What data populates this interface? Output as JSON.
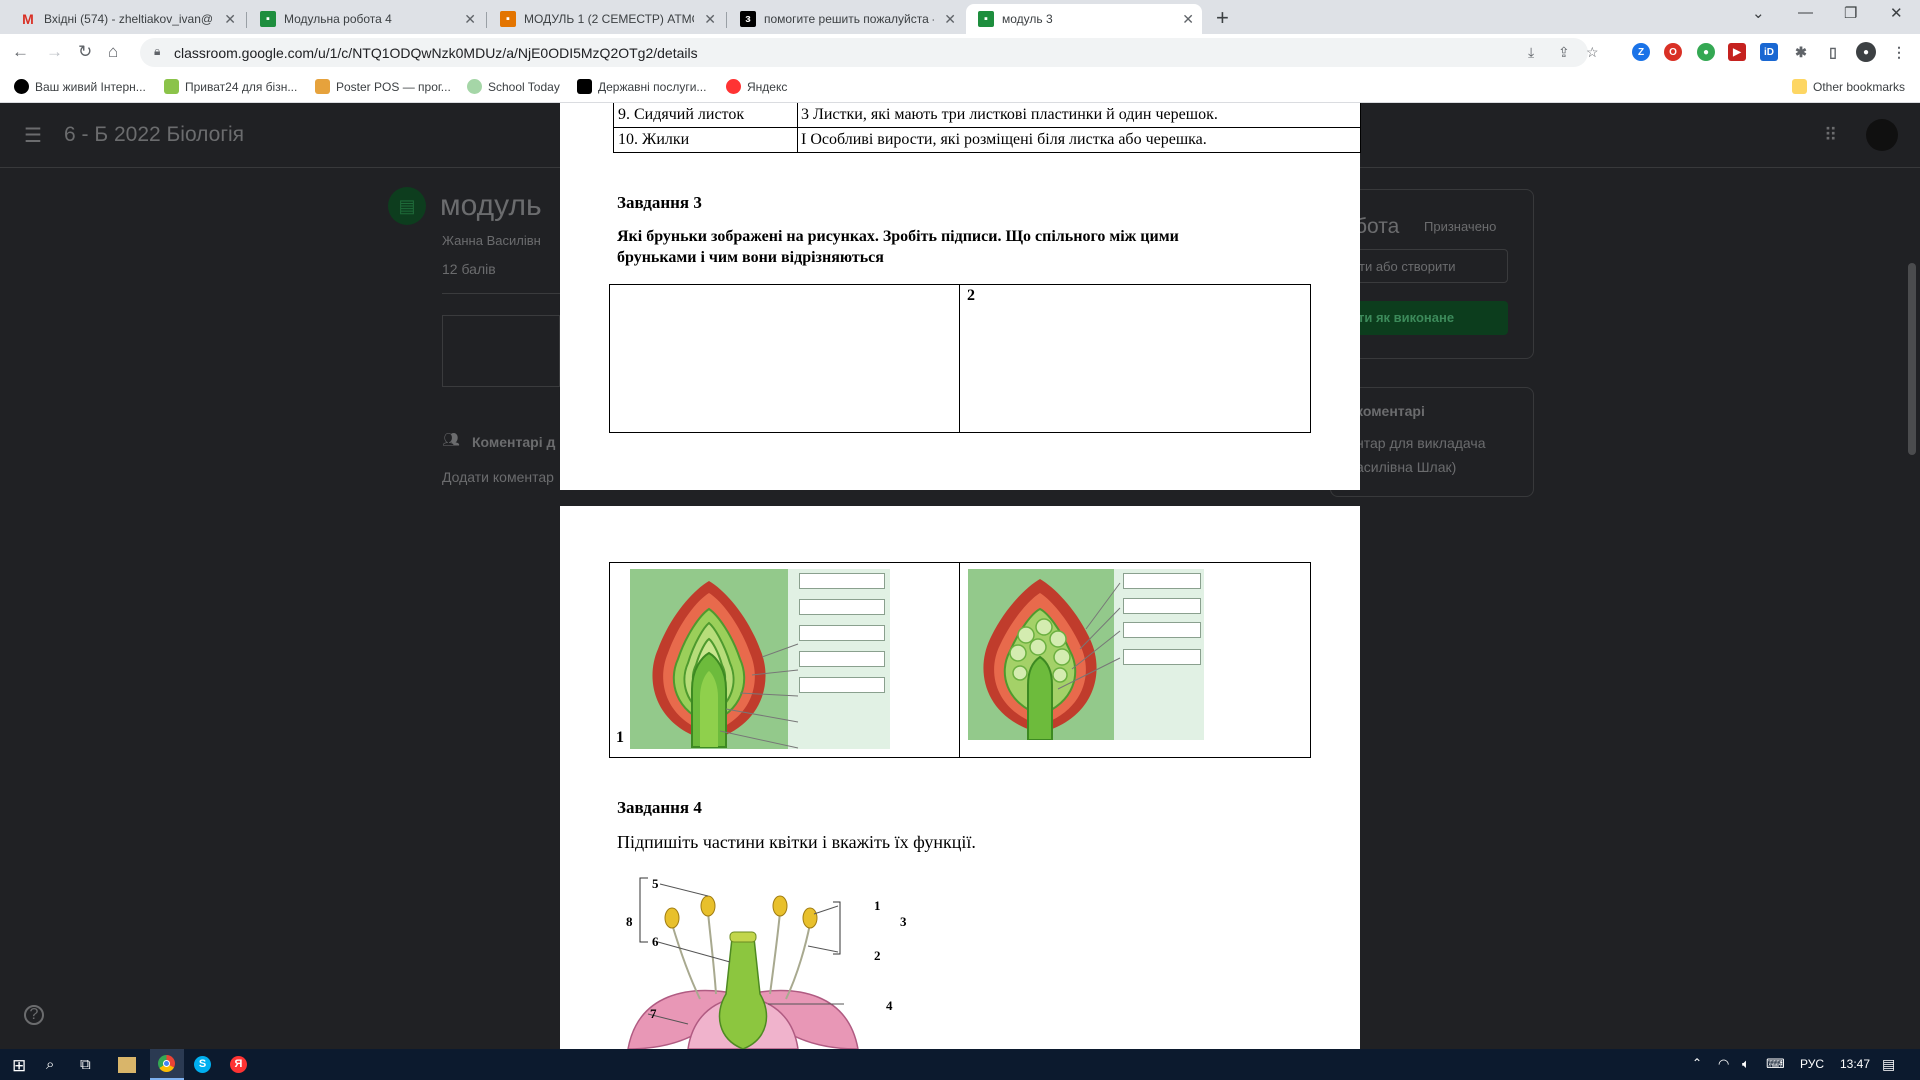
{
  "tabs": [
    {
      "label": "Вхідні (574) - zheltiakov_ivan@1",
      "icon": "gmail-icon"
    },
    {
      "label": "Модульна робота 4",
      "icon": "classroom-icon"
    },
    {
      "label": "МОДУЛЬ 1 (2 СЕМЕСТР) АТМОС",
      "icon": "forms-icon"
    },
    {
      "label": "помогите решить пожалуйста -",
      "icon": "znanija-icon"
    },
    {
      "label": "модуль 3",
      "icon": "classroom-icon"
    }
  ],
  "url": "classroom.google.com/u/1/c/NTQ1ODQwNzk0MDUz/a/NjE0ODI5MzQ2OTg2/details",
  "bookmarks": [
    "Ваш живий Інтерн...",
    "Приват24 для бізн...",
    "Poster POS — прог...",
    "School Today",
    "Державні послуги...",
    "Яндекс"
  ],
  "other_bookmarks": "Other bookmarks",
  "classroom": {
    "class_name": "6 - Б 2022 Біологія",
    "assignment_title": "модуль",
    "teacher": "Жанна Василівн",
    "points": "12 балів",
    "comments_label": "Коментарі д",
    "add_comment": "Додати коментар",
    "work_title": "бота",
    "status": "Призначено",
    "add_create": "ти або створити",
    "mark_done": "ти як виконане",
    "private_comments": "коментарі",
    "private_comment_for": "нтар для викладача",
    "teacher_name": "асилівна Шлак)"
  },
  "doc": {
    "table_rows": [
      {
        "term": "9.  Сидячий листок",
        "def": "3   Листки, які мають три листкові пластинки й один черешок."
      },
      {
        "term": "10.  Жилки",
        "def": "І   Особливі вирости, які розміщені біля листка або черешка."
      }
    ],
    "task3_title": "Завдання 3",
    "task3_text_line1": "Які бруньки зображені на рисунках. Зробіть підписи. Що спільного між цими",
    "task3_text_line2": "бруньками  і чим вони відрізняються",
    "answer_cell_label": "2",
    "figure1_label": "1",
    "task4_title": "Завдання 4",
    "task4_text": "Підпишіть частини квітки і вкажіть їх функції.",
    "flower_labels": [
      "5",
      "8",
      "6",
      "7",
      "1",
      "3",
      "2",
      "4"
    ]
  },
  "taskbar": {
    "lang": "РУС",
    "time": "13:47"
  }
}
